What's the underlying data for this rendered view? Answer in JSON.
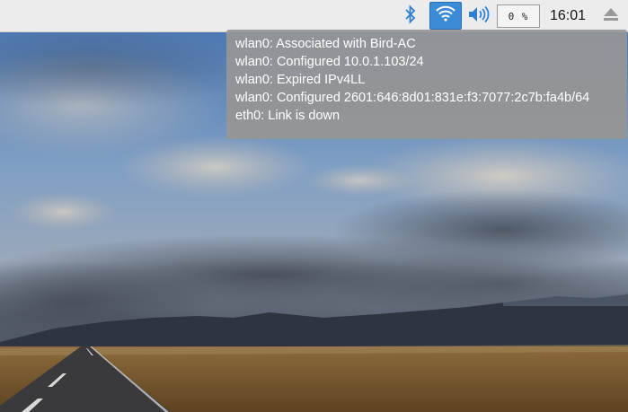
{
  "taskbar": {
    "icons": {
      "bluetooth": "bluetooth-icon",
      "wifi": "wifi-icon",
      "volume": "speaker-icon",
      "eject": "eject-icon"
    },
    "cpu_usage": "0 %",
    "clock": "16:01"
  },
  "network_tooltip": {
    "lines": [
      "wlan0: Associated with Bird-AC",
      "wlan0: Configured 10.0.1.103/24",
      "wlan0: Expired IPv4LL",
      "wlan0: Configured 2601:646:8d01:831e:f3:7077:2c7b:fa4b/64",
      "eth0: Link is down"
    ]
  },
  "colors": {
    "taskbar_bg": "#ececec",
    "wifi_active": "#3b8bd6",
    "icon_blue": "#2f7fd4",
    "tooltip_bg": "#969696"
  }
}
